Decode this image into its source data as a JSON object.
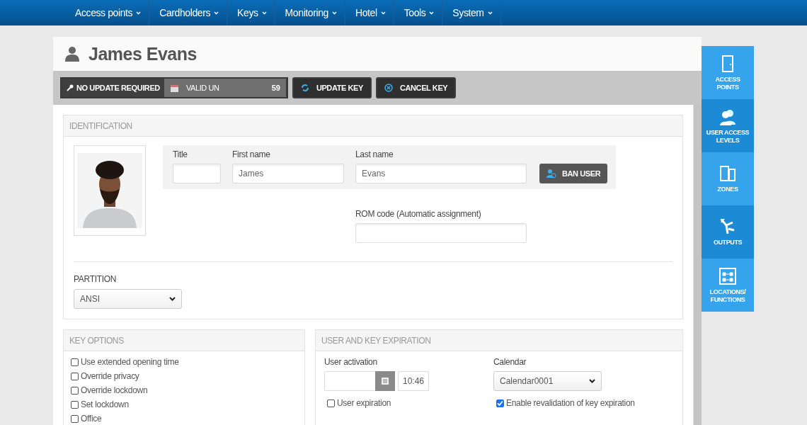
{
  "nav": [
    {
      "label": "Access points"
    },
    {
      "label": "Cardholders"
    },
    {
      "label": "Keys"
    },
    {
      "label": "Monitoring"
    },
    {
      "label": "Hotel"
    },
    {
      "label": "Tools"
    },
    {
      "label": "System"
    }
  ],
  "title": "James Evans",
  "toolbar": {
    "status": "NO UPDATE REQUIRED",
    "validity": "VALID UN",
    "validity_count": "59",
    "buttons": [
      {
        "label": "UPDATE KEY",
        "kind": "update"
      },
      {
        "label": "CANCEL KEY",
        "kind": "cancel"
      }
    ]
  },
  "identification": {
    "heading": "IDENTIFICATION",
    "fields": [
      {
        "label": "Title",
        "kind": "short"
      },
      {
        "label": "First name",
        "value": "James",
        "kind": "wide"
      },
      {
        "label": "Last name",
        "value": "Evans",
        "kind": "wide"
      }
    ],
    "ban_button": "BAN USER",
    "rom_label": "ROM code (Automatic assignment)",
    "partition_label": "PARTITION",
    "partition_value": "ANSI"
  },
  "key_options": {
    "heading": "KEY OPTIONS",
    "options": [
      {
        "label": "Use extended opening time",
        "checked": false
      },
      {
        "label": "Override privacy",
        "checked": false
      },
      {
        "label": "Override lockdown",
        "checked": false
      },
      {
        "label": "Set lockdown",
        "checked": false
      },
      {
        "label": "Office",
        "checked": false
      }
    ]
  },
  "expiration": {
    "heading": "USER AND KEY EXPIRATION",
    "activation_label": "User activation",
    "activation_time": "10:46",
    "calendar_label": "Calendar",
    "calendar_value": "Calendar0001",
    "user_expiration": {
      "label": "User expiration",
      "checked": false
    },
    "revalidation": {
      "label": "Enable revalidation of key expiration",
      "checked": true
    }
  },
  "side_panel": [
    {
      "label": "ACCESS POINTS",
      "kind": "door"
    },
    {
      "label": "USER ACCESS LEVELS",
      "kind": "users"
    },
    {
      "label": "ZONES",
      "kind": "zones"
    },
    {
      "label": "OUTPUTS",
      "kind": "outputs"
    },
    {
      "label": "LOCATIONS/ FUNCTIONS",
      "kind": "locations"
    }
  ]
}
